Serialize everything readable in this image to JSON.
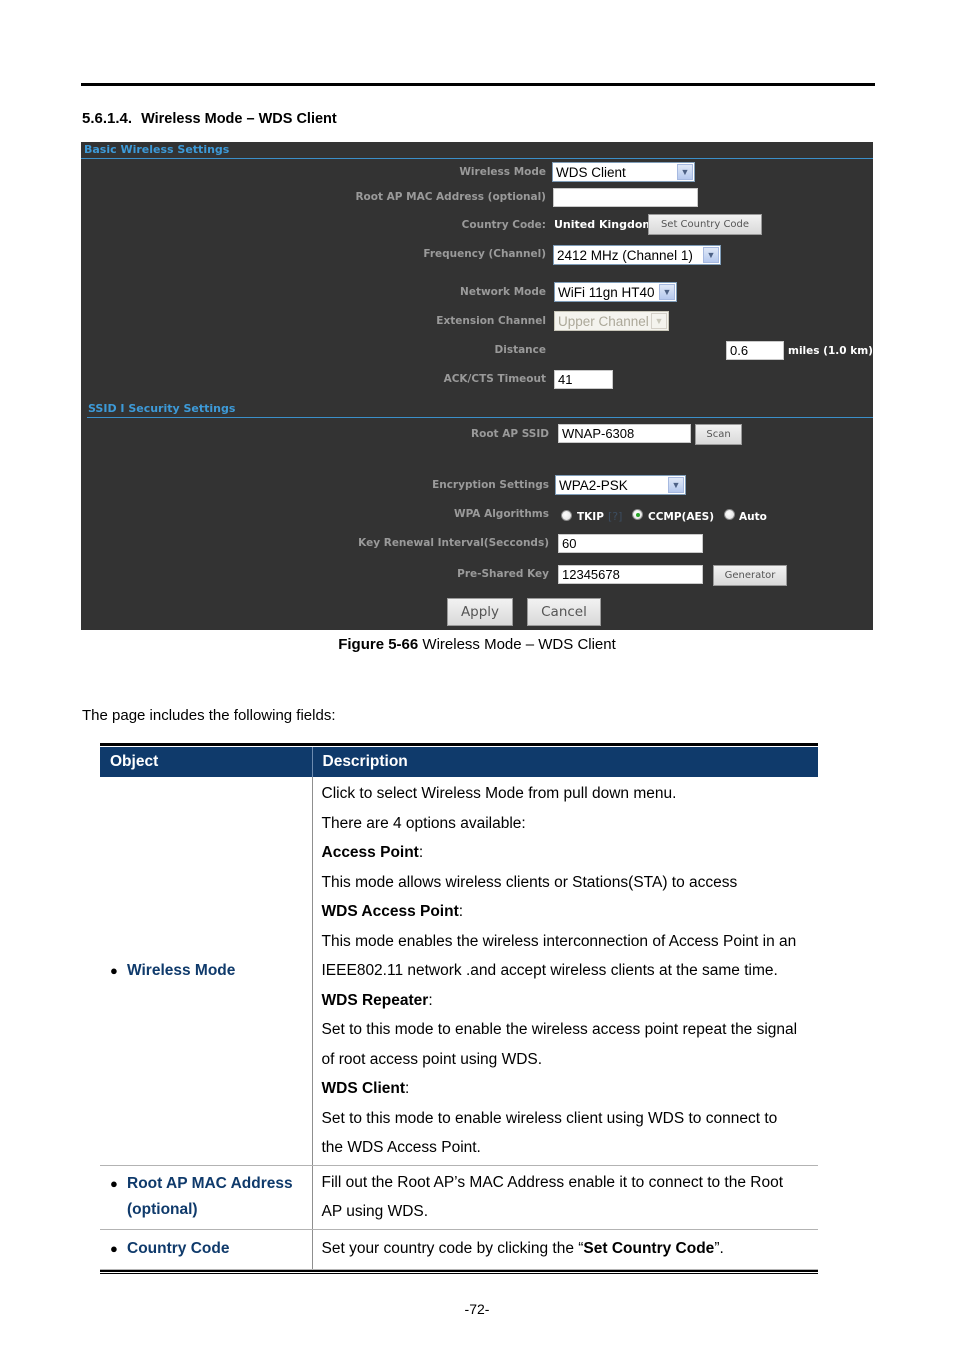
{
  "document": {
    "section_number": "5.6.1.4.",
    "section_title": "Wireless Mode – WDS Client",
    "figure_label": "Figure 5-66",
    "figure_title": "Wireless Mode – WDS Client",
    "intro_text": "The page includes the following fields:",
    "page_number": "-72-"
  },
  "ui": {
    "basic_section_title": "Basic Wireless Settings",
    "ssid_section_title": "SSID I Security Settings",
    "wireless_mode": {
      "label": "Wireless Mode",
      "value": "WDS Client"
    },
    "root_mac": {
      "label": "Root AP MAC Address (optional)",
      "value": ""
    },
    "country": {
      "label": "Country Code:",
      "value": "United Kingdom",
      "button": "Set Country Code"
    },
    "frequency": {
      "label": "Frequency (Channel)",
      "value": "2412 MHz (Channel 1)"
    },
    "network_mode": {
      "label": "Network Mode",
      "value": "WiFi 11gn HT40"
    },
    "extension_channel": {
      "label": "Extension Channel",
      "value": "Upper Channel"
    },
    "distance": {
      "label": "Distance",
      "value": "0.6",
      "unit": "miles (1.0 km)"
    },
    "ack_timeout": {
      "label": "ACK/CTS Timeout",
      "value": "41"
    },
    "root_ssid": {
      "label": "Root AP SSID",
      "value": "WNAP-6308",
      "button": "Scan"
    },
    "encryption": {
      "label": "Encryption Settings",
      "value": "WPA2-PSK"
    },
    "wpa_algorithms": {
      "label": "WPA Algorithms",
      "options": [
        "TKIP",
        "CCMP(AES)",
        "Auto"
      ],
      "selected": "CCMP(AES)",
      "help": "[?]"
    },
    "key_renewal": {
      "label": "Key Renewal Interval(Secconds)",
      "value": "60"
    },
    "psk": {
      "label": "Pre-Shared Key",
      "value": "12345678",
      "button": "Generator"
    },
    "apply_button": "Apply",
    "cancel_button": "Cancel",
    "dropdown_arrow": "chevron-down-icon"
  },
  "table": {
    "headers": [
      "Object",
      "Description"
    ],
    "rows": [
      {
        "object": "Wireless Mode",
        "description": [
          {
            "text": "Click to select Wireless Mode from pull down menu."
          },
          {
            "text": "There are 4 options available:"
          },
          {
            "bold": "Access Point",
            "text": ":"
          },
          {
            "text": "This mode allows wireless clients or Stations(STA) to access"
          },
          {
            "bold": "WDS Access Point",
            "text": ":"
          },
          {
            "text": "This mode enables the wireless interconnection of Access Point in an"
          },
          {
            "text": "IEEE802.11 network .and accept wireless clients at the same time."
          },
          {
            "bold": "WDS Repeater",
            "text": ":"
          },
          {
            "text": "Set to this mode to enable the wireless access point repeat the signal"
          },
          {
            "text": "of root access point using WDS."
          },
          {
            "bold": "WDS Client",
            "text": ":"
          },
          {
            "text": "Set to this mode to enable wireless client using WDS to connect to"
          },
          {
            "text": "the WDS Access Point."
          }
        ]
      },
      {
        "object_line1": "Root AP MAC Address",
        "object_line2": "(optional)",
        "description_line1": "Fill out the Root AP’s MAC Address enable it to connect to the Root",
        "description_line2": "AP using WDS."
      },
      {
        "object": "Country Code",
        "description_pre": "Set your country code by clicking the “",
        "description_bold": "Set Country Code",
        "description_post": "”."
      }
    ]
  }
}
